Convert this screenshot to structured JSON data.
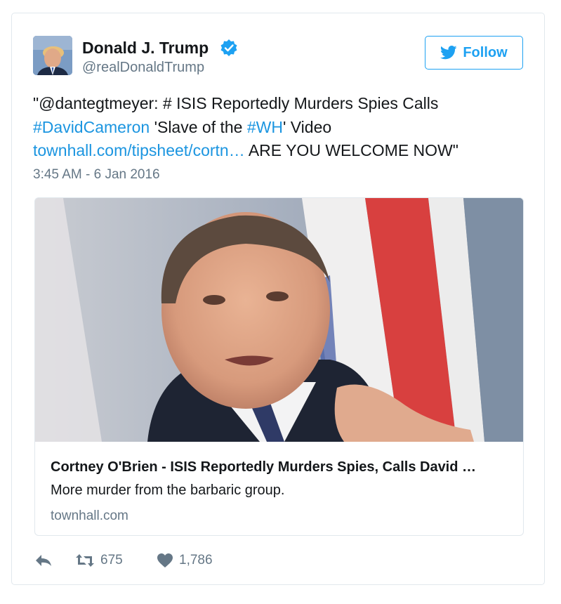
{
  "author": {
    "name": "Donald J. Trump",
    "handle": "@realDonaldTrump",
    "verified": true
  },
  "follow_button": {
    "label": "Follow",
    "icon": "twitter-bird-icon",
    "color": "#1da1f2"
  },
  "tweet": {
    "line1": "\"@dantegtmeyer: # ISIS Reportedly Murders Spies Calls",
    "hashtag1": "#DavidCameron",
    "text_mid": " 'Slave of the ",
    "hashtag2": "#WH",
    "text_end": "' Video",
    "link": "townhall.com/tipsheet/cortn…",
    "text_tail": " ARE YOU WELCOME NOW\"",
    "timestamp": "3:45 AM - 6 Jan 2016"
  },
  "card": {
    "image": "photo-of-man-in-suit-pointing",
    "title": "Cortney O'Brien - ISIS Reportedly Murders Spies, Calls David …",
    "description": "More murder from the barbaric group.",
    "domain": "townhall.com"
  },
  "actions": {
    "reply_icon": "reply-icon",
    "retweet_icon": "retweet-icon",
    "retweet_count": "675",
    "like_icon": "heart-icon",
    "like_count": "1,786"
  },
  "colors": {
    "link": "#1b95e0",
    "muted": "#657786",
    "border": "#e1e8ed",
    "accent": "#1da1f2"
  }
}
